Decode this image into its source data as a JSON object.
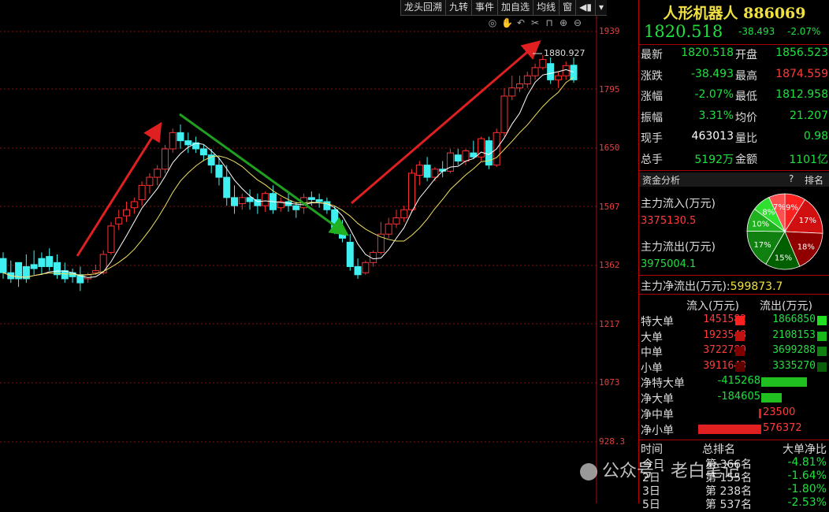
{
  "toolbar": {
    "items": [
      "龙头回溯",
      "九转",
      "事件",
      "加自选",
      "均线",
      "窗",
      "◀▮",
      "▾"
    ]
  },
  "tools": {
    "icons": [
      "eye-icon",
      "hand-icon",
      "undo-icon",
      "cut-icon",
      "lock-icon",
      "zoom-in-icon",
      "zoom-out-icon"
    ]
  },
  "y_axis": {
    "labels": [
      "1939",
      "1795",
      "1650",
      "1507",
      "1362",
      "1217",
      "1073",
      "928.3"
    ]
  },
  "max_label": "1880.927",
  "chart_data": {
    "type": "candlestick",
    "ylim": [
      928.3,
      1939
    ],
    "candles": [
      [
        1380,
        1395,
        1345,
        1330
      ],
      [
        1345,
        1375,
        1330,
        1320
      ],
      [
        1370,
        1360,
        1330,
        1310
      ],
      [
        1360,
        1390,
        1330,
        1320
      ],
      [
        1365,
        1400,
        1355,
        1340
      ],
      [
        1380,
        1395,
        1360,
        1340
      ],
      [
        1385,
        1405,
        1360,
        1350
      ],
      [
        1370,
        1390,
        1340,
        1330
      ],
      [
        1350,
        1370,
        1330,
        1320
      ],
      [
        1345,
        1355,
        1335,
        1320
      ],
      [
        1340,
        1360,
        1320,
        1300
      ],
      [
        1330,
        1345,
        1340,
        1320
      ],
      [
        1345,
        1365,
        1350,
        1340
      ],
      [
        1345,
        1400,
        1390,
        1340
      ],
      [
        1395,
        1470,
        1460,
        1390
      ],
      [
        1465,
        1500,
        1480,
        1450
      ],
      [
        1485,
        1520,
        1500,
        1470
      ],
      [
        1505,
        1530,
        1520,
        1490
      ],
      [
        1525,
        1570,
        1560,
        1510
      ],
      [
        1560,
        1590,
        1580,
        1540
      ],
      [
        1580,
        1610,
        1600,
        1560
      ],
      [
        1600,
        1660,
        1650,
        1590
      ],
      [
        1650,
        1700,
        1690,
        1640
      ],
      [
        1690,
        1710,
        1670,
        1650
      ],
      [
        1670,
        1690,
        1660,
        1640
      ],
      [
        1665,
        1680,
        1650,
        1640
      ],
      [
        1650,
        1660,
        1635,
        1620
      ],
      [
        1635,
        1650,
        1610,
        1590
      ],
      [
        1610,
        1630,
        1580,
        1560
      ],
      [
        1580,
        1610,
        1530,
        1510
      ],
      [
        1530,
        1560,
        1510,
        1490
      ],
      [
        1515,
        1540,
        1530,
        1500
      ],
      [
        1530,
        1550,
        1520,
        1500
      ],
      [
        1525,
        1540,
        1510,
        1490
      ],
      [
        1510,
        1545,
        1540,
        1495
      ],
      [
        1540,
        1560,
        1500,
        1490
      ],
      [
        1505,
        1530,
        1520,
        1495
      ],
      [
        1520,
        1540,
        1510,
        1495
      ],
      [
        1510,
        1520,
        1500,
        1480
      ],
      [
        1505,
        1540,
        1530,
        1490
      ],
      [
        1530,
        1545,
        1525,
        1510
      ],
      [
        1525,
        1540,
        1520,
        1505
      ],
      [
        1520,
        1530,
        1500,
        1490
      ],
      [
        1500,
        1510,
        1450,
        1440
      ],
      [
        1450,
        1475,
        1430,
        1420
      ],
      [
        1420,
        1440,
        1360,
        1350
      ],
      [
        1360,
        1380,
        1340,
        1330
      ],
      [
        1345,
        1375,
        1370,
        1340
      ],
      [
        1370,
        1400,
        1395,
        1360
      ],
      [
        1395,
        1470,
        1440,
        1390
      ],
      [
        1440,
        1480,
        1465,
        1430
      ],
      [
        1465,
        1500,
        1480,
        1455
      ],
      [
        1480,
        1510,
        1500,
        1470
      ],
      [
        1500,
        1600,
        1590,
        1495
      ],
      [
        1585,
        1620,
        1610,
        1560
      ],
      [
        1610,
        1630,
        1580,
        1570
      ],
      [
        1580,
        1605,
        1600,
        1570
      ],
      [
        1600,
        1620,
        1595,
        1580
      ],
      [
        1595,
        1650,
        1640,
        1590
      ],
      [
        1635,
        1650,
        1620,
        1610
      ],
      [
        1620,
        1650,
        1645,
        1610
      ],
      [
        1640,
        1670,
        1630,
        1625
      ],
      [
        1630,
        1680,
        1675,
        1620
      ],
      [
        1670,
        1680,
        1610,
        1600
      ],
      [
        1610,
        1700,
        1690,
        1605
      ],
      [
        1690,
        1800,
        1780,
        1680
      ],
      [
        1780,
        1830,
        1800,
        1770
      ],
      [
        1800,
        1830,
        1810,
        1790
      ],
      [
        1810,
        1840,
        1830,
        1800
      ],
      [
        1830,
        1860,
        1850,
        1820
      ],
      [
        1850,
        1881,
        1870,
        1845
      ],
      [
        1860,
        1875,
        1820,
        1810
      ],
      [
        1820,
        1840,
        1830,
        1800
      ],
      [
        1830,
        1865,
        1855,
        1820
      ],
      [
        1856,
        1875,
        1820,
        1813
      ]
    ]
  },
  "panel": {
    "name": "人形机器人",
    "code": "886069",
    "price": "1820.518",
    "change": "-38.493",
    "pct": "-2.07%",
    "quotes": [
      {
        "l1": "最新",
        "v1": "1820.518",
        "c1": "green",
        "l2": "开盘",
        "v2": "1856.523",
        "c2": "green"
      },
      {
        "l1": "涨跌",
        "v1": "-38.493",
        "c1": "green",
        "l2": "最高",
        "v2": "1874.559",
        "c2": "red"
      },
      {
        "l1": "涨幅",
        "v1": "-2.07%",
        "c1": "green",
        "l2": "最低",
        "v2": "1812.958",
        "c2": "green"
      },
      {
        "l1": "振幅",
        "v1": "3.31%",
        "c1": "green",
        "l2": "均价",
        "v2": "21.207",
        "c2": "green"
      },
      {
        "l1": "现手",
        "v1": "463013",
        "c1": "white",
        "l2": "量比",
        "v2": "0.98",
        "c2": "green"
      },
      {
        "l1": "总手",
        "v1": "5192万",
        "c1": "green",
        "l2": "金额",
        "v2": "1101亿",
        "c2": "green"
      }
    ],
    "section": "资金分析",
    "section_help": "?",
    "section_rank": "排名",
    "inflow_label": "主力流入(万元)",
    "inflow_value": "3375130.5",
    "outflow_label": "主力流出(万元)",
    "outflow_value": "3975004.1",
    "net_label": "主力净流出(万元):",
    "net_value": "599873.7",
    "pie": [
      {
        "label": "9%",
        "value": 9,
        "color": "#ff2020"
      },
      {
        "label": "17%",
        "value": 17,
        "color": "#d01010"
      },
      {
        "label": "18%",
        "value": 18,
        "color": "#900000"
      },
      {
        "label": "15%",
        "value": 15,
        "color": "#006000"
      },
      {
        "label": "17%",
        "value": 17,
        "color": "#108010"
      },
      {
        "label": "10%",
        "value": 10,
        "color": "#20b020"
      },
      {
        "label": "8%",
        "value": 8,
        "color": "#30e030"
      },
      {
        "label": "7%",
        "value": 7,
        "color": "#ff5050"
      }
    ],
    "table_head": {
      "in": "流入(万元)",
      "out": "流出(万元)"
    },
    "rows": [
      {
        "label": "特大单",
        "in": "1451582",
        "out": "1866850"
      },
      {
        "label": "大单",
        "in": "1923548",
        "out": "2108153"
      },
      {
        "label": "中单",
        "in": "3722789",
        "out": "3699288"
      },
      {
        "label": "小单",
        "in": "3911643",
        "out": "3335270"
      }
    ],
    "net_rows": [
      {
        "label": "净特大单",
        "value": "-415268",
        "amount": -415268
      },
      {
        "label": "净大单",
        "value": "-184605",
        "amount": -184605
      },
      {
        "label": "净中单",
        "value": "23500",
        "amount": 23500
      },
      {
        "label": "净小单",
        "value": "576372",
        "amount": 576372
      }
    ],
    "rank_head": {
      "time": "时间",
      "rank": "总排名",
      "ratio": "大单净比"
    },
    "rank_rows": [
      {
        "time": "今日",
        "rank": "第 366名",
        "ratio": "-4.81%"
      },
      {
        "time": "2日",
        "rank": "第 155名",
        "ratio": "-1.64%"
      },
      {
        "time": "3日",
        "rank": "第 238名",
        "ratio": "-1.80%"
      },
      {
        "time": "5日",
        "rank": "第 537名",
        "ratio": "-2.53%"
      }
    ]
  },
  "watermark": "公众号 · 老白笔记"
}
